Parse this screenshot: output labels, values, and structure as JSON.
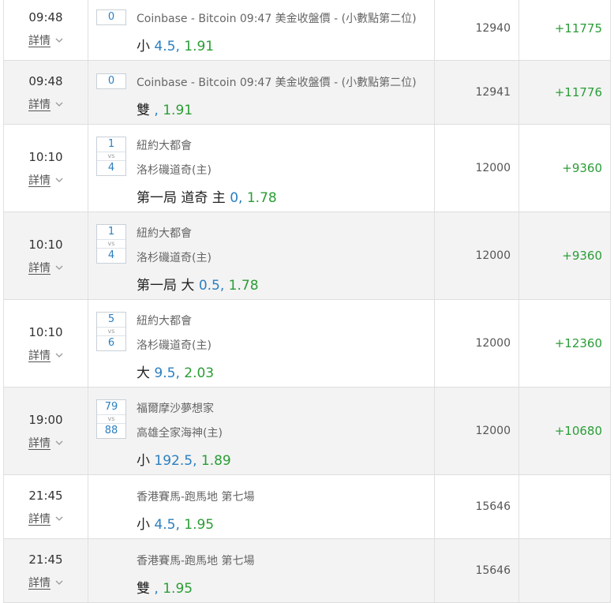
{
  "rows": [
    {
      "time": "09:48",
      "detail": "詳情",
      "score": "0",
      "line1": "Coinbase - Bitcoin 09:47 美金收盤價 - (小數點第二位)",
      "pick_label": "小",
      "pick_num": "4.5",
      "odds": "1.91",
      "amount": "12940",
      "win": "+11775"
    },
    {
      "time": "09:48",
      "detail": "詳情",
      "score": "0",
      "line1": "Coinbase - Bitcoin 09:47 美金收盤價 - (小數點第二位)",
      "pick_label": "雙",
      "pick_num": "",
      "odds": "1.91",
      "amount": "12941",
      "win": "+11776"
    },
    {
      "time": "10:10",
      "detail": "詳情",
      "score_home": "1",
      "score_vs": "vs",
      "score_away": "4",
      "team_home": "紐約大都會",
      "team_away": "洛杉磯道奇(主)",
      "pick_label": "第一局 道奇 主",
      "pick_num": "0",
      "odds": "1.78",
      "amount": "12000",
      "win": "+9360"
    },
    {
      "time": "10:10",
      "detail": "詳情",
      "score_home": "1",
      "score_vs": "vs",
      "score_away": "4",
      "team_home": "紐約大都會",
      "team_away": "洛杉磯道奇(主)",
      "pick_label": "第一局 大",
      "pick_num": "0.5",
      "odds": "1.78",
      "amount": "12000",
      "win": "+9360"
    },
    {
      "time": "10:10",
      "detail": "詳情",
      "score_home": "5",
      "score_vs": "vs",
      "score_away": "6",
      "team_home": "紐約大都會",
      "team_away": "洛杉磯道奇(主)",
      "pick_label": "大",
      "pick_num": "9.5",
      "odds": "2.03",
      "amount": "12000",
      "win": "+12360"
    },
    {
      "time": "19:00",
      "detail": "詳情",
      "score_home": "79",
      "score_vs": "vs",
      "score_away": "88",
      "team_home": "福爾摩沙夢想家",
      "team_away": "高雄全家海神(主)",
      "pick_label": "小",
      "pick_num": "192.5",
      "odds": "1.89",
      "amount": "12000",
      "win": "+10680"
    },
    {
      "time": "21:45",
      "detail": "詳情",
      "line1": "香港賽馬-跑馬地 第七場",
      "pick_label": "小",
      "pick_num": "4.5",
      "odds": "1.95",
      "amount": "15646",
      "win": ""
    },
    {
      "time": "21:45",
      "detail": "詳情",
      "line1": "香港賽馬-跑馬地 第七場",
      "pick_label": "雙",
      "pick_num": "",
      "odds": "1.95",
      "amount": "15646",
      "win": ""
    }
  ],
  "colors": {
    "win": "#2a9d36",
    "number": "#2b7fc1",
    "alt_row": "#f3f3f3"
  },
  "icons": {
    "expand": "chevron-down-icon"
  }
}
